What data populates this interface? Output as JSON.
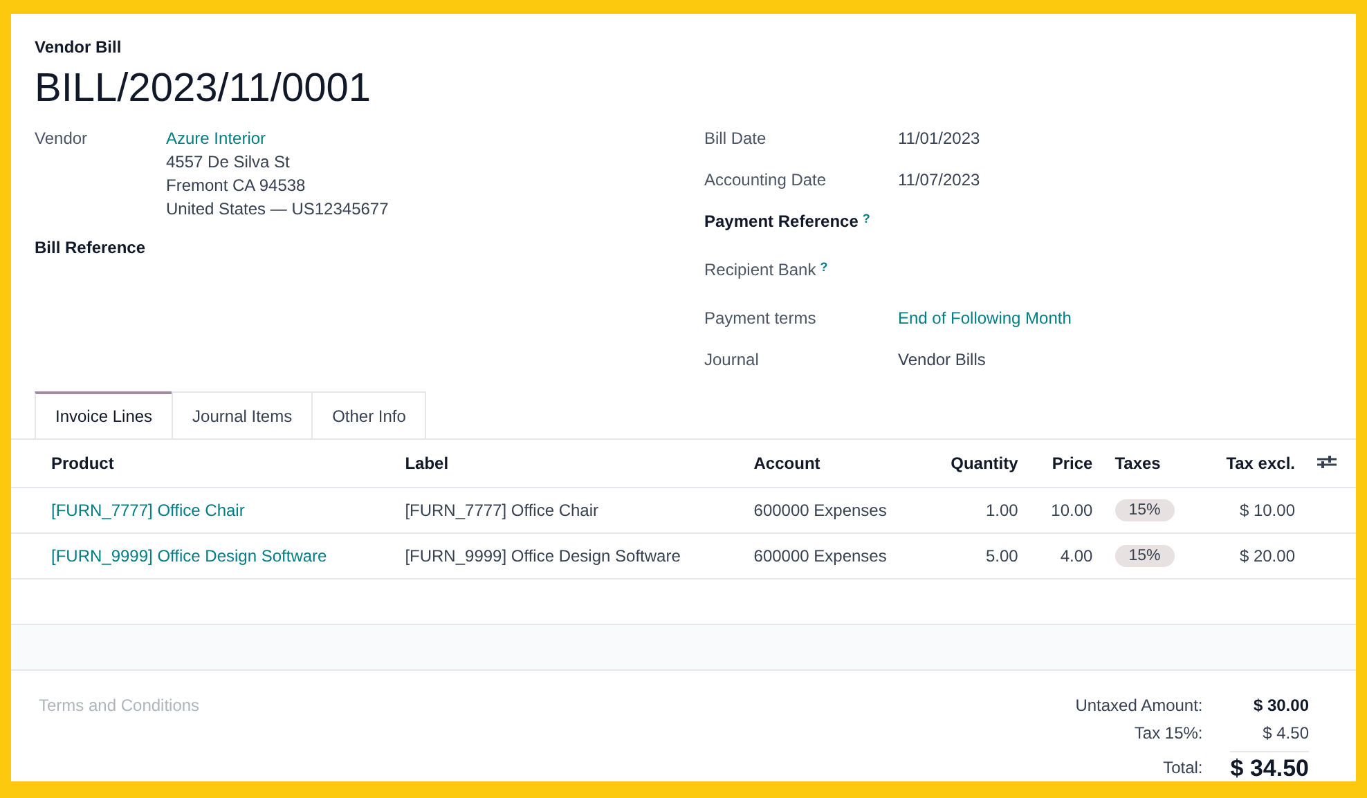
{
  "header": {
    "subtitle": "Vendor Bill",
    "title": "BILL/2023/11/0001"
  },
  "left_fields": [
    {
      "label": "Vendor",
      "required": false,
      "value": {
        "text": "Azure Interior",
        "link": true
      },
      "address": [
        "4557 De Silva St",
        "Fremont CA 94538",
        "United States — US12345677"
      ]
    },
    {
      "label": "Bill Reference",
      "required": true
    }
  ],
  "right_fields": [
    {
      "label": "Bill Date",
      "required": false,
      "value": {
        "text": "11/01/2023",
        "link": false
      }
    },
    {
      "label": "Accounting Date",
      "required": false,
      "value": {
        "text": "11/07/2023",
        "link": false
      }
    },
    {
      "label": "Payment Reference",
      "required": true,
      "help_mark": "?"
    },
    {
      "label": "Recipient Bank",
      "required": false,
      "help_mark": "?"
    },
    {
      "label": "Payment terms",
      "required": false,
      "value": {
        "text": "End of Following Month",
        "link": true
      }
    },
    {
      "label": "Journal",
      "required": false,
      "value": {
        "text": "Vendor Bills",
        "link": false
      }
    }
  ],
  "tabs": [
    {
      "label": "Invoice Lines",
      "selected": true
    },
    {
      "label": "Journal Items",
      "selected": false
    },
    {
      "label": "Other Info",
      "selected": false
    }
  ],
  "table": {
    "columns": [
      "Product",
      "Label",
      "Account",
      "Quantity",
      "Price",
      "Taxes",
      "Tax excl."
    ],
    "rows": [
      {
        "product": "[FURN_7777] Office Chair",
        "label": "[FURN_7777] Office Chair",
        "account": "600000 Expenses",
        "quantity": "1.00",
        "price": "10.00",
        "taxes": "15%",
        "tax_excl": "$ 10.00"
      },
      {
        "product": "[FURN_9999] Office Design Software",
        "label": "[FURN_9999] Office Design Software",
        "account": "600000 Expenses",
        "quantity": "5.00",
        "price": "4.00",
        "taxes": "15%",
        "tax_excl": "$ 20.00"
      }
    ]
  },
  "terms": {
    "placeholder": "Terms and Conditions"
  },
  "totals": [
    {
      "kind": "subtotal",
      "label": "Untaxed Amount:",
      "value": "$ 30.00"
    },
    {
      "kind": "tax",
      "label": "Tax 15%:",
      "value": "$ 4.50"
    },
    {
      "kind": "total",
      "label": "Total:",
      "value": "$ 34.50"
    }
  ]
}
